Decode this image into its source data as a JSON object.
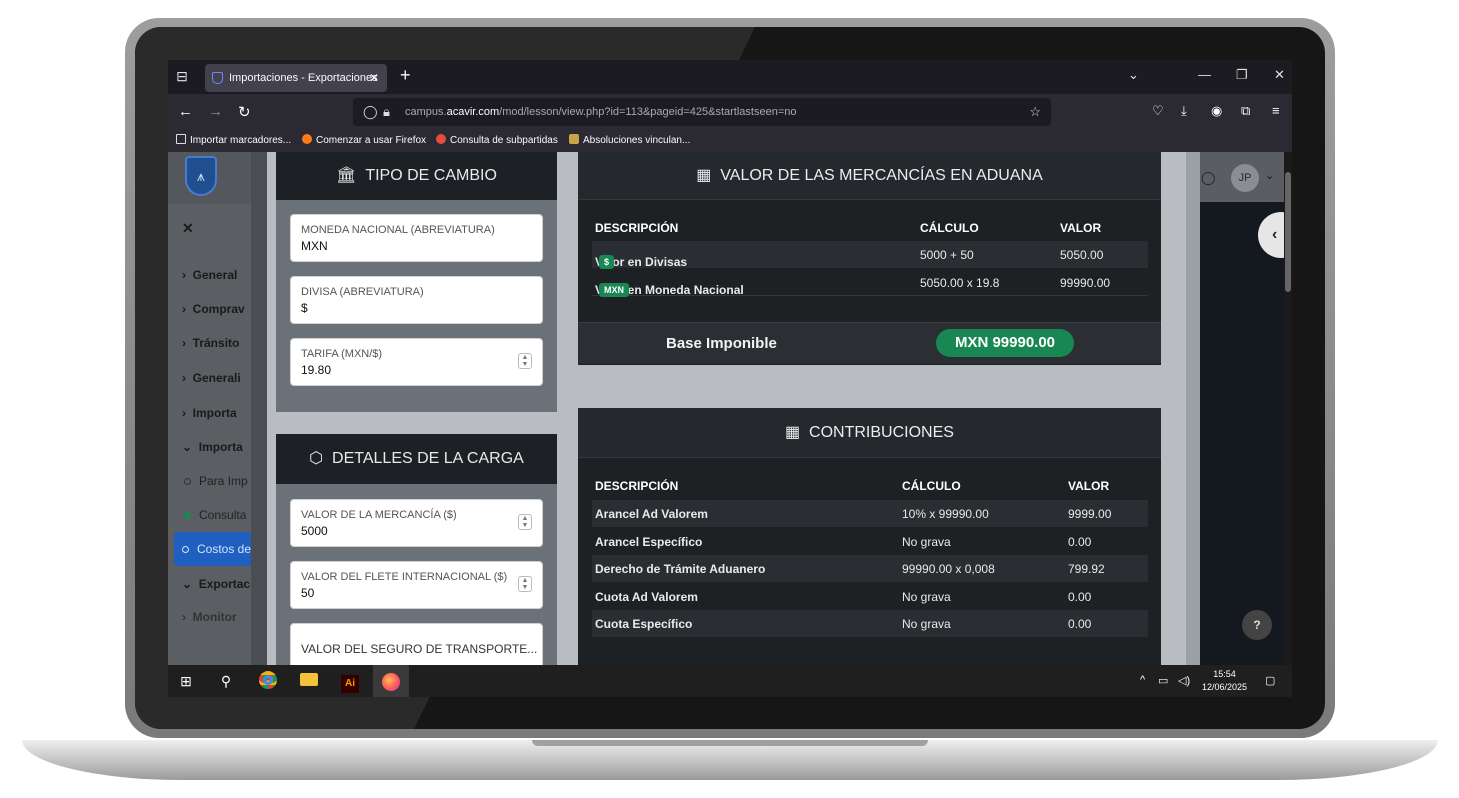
{
  "browser": {
    "tab_title": "Importaciones - Exportaciones",
    "url_prefix": "campus.",
    "url_host": "acavir.com",
    "url_path": "/mod/lesson/view.php?id=113&pageid=425&startlastseen=no",
    "bookmarks": [
      "Importar marcadores...",
      "Comenzar a usar Firefox",
      "Consulta de subpartidas",
      "Absoluciones vinculan..."
    ]
  },
  "sidebar": {
    "items": [
      "General",
      "Comprav",
      "Tránsito",
      "Generali",
      "Importa",
      "Importa"
    ],
    "subitems": [
      "Para Imp",
      "Consulta"
    ],
    "active_item": "Costos de",
    "bottom_items": [
      "Exportac",
      "Monitor"
    ]
  },
  "user": {
    "initials": "JP"
  },
  "tipo_cambio": {
    "title": "TIPO DE CAMBIO",
    "fields": [
      {
        "label": "MONEDA NACIONAL (ABREVIATURA)",
        "value": "MXN"
      },
      {
        "label": "DIVISA (ABREVIATURA)",
        "value": "$"
      },
      {
        "label": "TARIFA (MXN/$)",
        "value": "19.80"
      }
    ]
  },
  "detalles_carga": {
    "title": "DETALLES DE LA CARGA",
    "fields": [
      {
        "label": "VALOR DE LA MERCANCÍA ($)",
        "value": "5000"
      },
      {
        "label": "VALOR DEL FLETE INTERNACIONAL ($)",
        "value": "50"
      },
      {
        "label": "VALOR DEL SEGURO DE TRANSPORTE...",
        "value": ""
      }
    ]
  },
  "valor_aduana": {
    "title": "VALOR DE LAS MERCANCÍAS EN ADUANA",
    "headers": [
      "DESCRIPCIÓN",
      "CÁLCULO",
      "VALOR"
    ],
    "rows": [
      {
        "desc": "Valor en Divisas",
        "badge": "$",
        "calc": "5000 + 50",
        "value": "5050.00"
      },
      {
        "desc": "Valor en Moneda Nacional",
        "badge": "MXN",
        "calc": "5050.00 x 19.8",
        "value": "99990.00"
      }
    ],
    "base_label": "Base Imponible",
    "base_value": "MXN 99990.00"
  },
  "contribuciones": {
    "title": "CONTRIBUCIONES",
    "headers": [
      "DESCRIPCIÓN",
      "CÁLCULO",
      "VALOR"
    ],
    "rows": [
      {
        "desc": "Arancel Ad Valorem",
        "calc": "10% x 99990.00",
        "value": "9999.00"
      },
      {
        "desc": "Arancel Específico",
        "calc": "No grava",
        "value": "0.00"
      },
      {
        "desc": "Derecho de Trámite Aduanero",
        "calc": "99990.00 x 0,008",
        "value": "799.92"
      },
      {
        "desc": "Cuota Ad Valorem",
        "calc": "No grava",
        "value": "0.00"
      },
      {
        "desc": "Cuota Específico",
        "calc": "No grava",
        "value": "0.00"
      }
    ]
  },
  "taskbar": {
    "time": "15:54",
    "date": "12/06/2025"
  },
  "colors": {
    "accent_green": "#198754",
    "active_blue": "#1f5fbf"
  }
}
